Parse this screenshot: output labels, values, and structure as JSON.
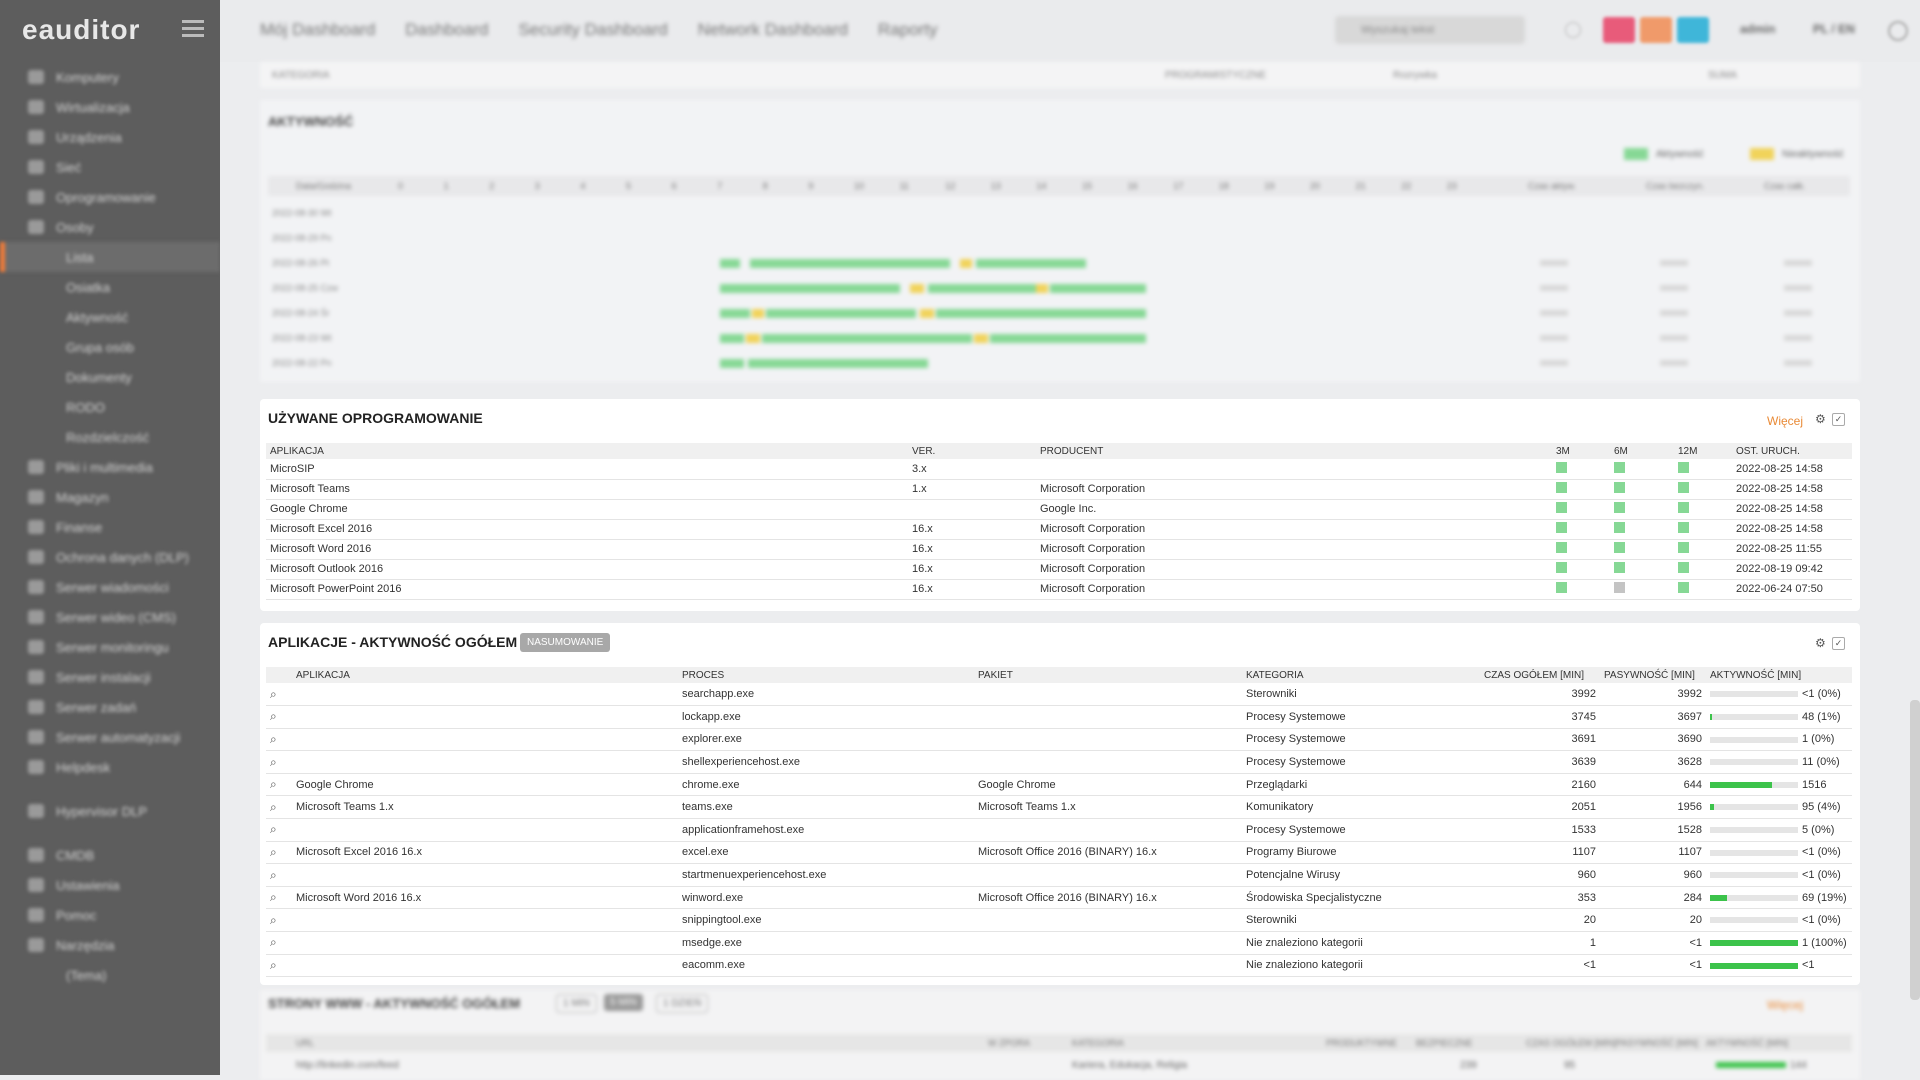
{
  "sidebar": {
    "logo": "eauditor",
    "items": [
      {
        "label": "Komputery",
        "sub": false
      },
      {
        "label": "Wirtualizacja",
        "sub": false
      },
      {
        "label": "Urządzenia",
        "sub": false
      },
      {
        "label": "Sieć",
        "sub": false
      },
      {
        "label": "Oprogramowanie",
        "sub": false
      },
      {
        "label": "Osoby",
        "sub": false
      },
      {
        "label": "Lista",
        "sub": true,
        "active": true
      },
      {
        "label": "Osiatka",
        "sub": true
      },
      {
        "label": "Aktywność",
        "sub": true
      },
      {
        "label": "Grupa osób",
        "sub": true
      },
      {
        "label": "Dokumenty",
        "sub": true
      },
      {
        "label": "RODO",
        "sub": true
      },
      {
        "label": "Rozdzielczość",
        "sub": true
      },
      {
        "label": "Pliki i multimedia",
        "sub": false
      },
      {
        "label": "Magazyn",
        "sub": false
      },
      {
        "label": "Finanse",
        "sub": false
      },
      {
        "label": "Ochrona danych (DLP)",
        "sub": false
      },
      {
        "label": "Serwer wiadomości",
        "sub": false
      },
      {
        "label": "Serwer wideo (CMS)",
        "sub": false
      },
      {
        "label": "Serwer monitoringu",
        "sub": false
      },
      {
        "label": "Serwer instalacji",
        "sub": false
      },
      {
        "label": "Serwer zadań",
        "sub": false
      },
      {
        "label": "Serwer automatyzacji",
        "sub": false
      },
      {
        "label": "Helpdesk",
        "sub": false
      },
      {
        "label": "Hypervisor DLP",
        "sub": false,
        "gap": true
      },
      {
        "label": "CMDB",
        "sub": false,
        "gap": true
      },
      {
        "label": "Ustawienia",
        "sub": false
      },
      {
        "label": "Pomoc",
        "sub": false
      },
      {
        "label": "Narzędzia",
        "sub": false
      },
      {
        "label": "(Tema)",
        "sub": true
      }
    ]
  },
  "topnav": {
    "items": [
      "Mój Dashboard",
      "Dashboard",
      "Security Dashboard",
      "Network Dashboard",
      "Raporty"
    ],
    "search_placeholder": "Wyszukaj tekst",
    "user": "admin",
    "lang": "PL / EN"
  },
  "activity": {
    "title": "AKTYWNOŚĆ",
    "legend": [
      "Aktywność",
      "Nieaktywność"
    ],
    "top_headers": [
      "KATEGORIA",
      "PROGRAMISTYCZNE",
      "Rozrywka",
      "SUMA"
    ],
    "col_head": [
      "Data/Godzina",
      "0",
      "1",
      "2",
      "3",
      "4",
      "5",
      "6",
      "7",
      "8",
      "9",
      "10",
      "11",
      "12",
      "13",
      "14",
      "15",
      "16",
      "17",
      "18",
      "19",
      "20",
      "21",
      "22",
      "23",
      "Czas aktyw.",
      "Czas bezczyn.",
      "Czas całk."
    ],
    "dates": [
      "2022-08-30 Wt",
      "2022-08-29 Pn",
      "2022-08-26 Pt",
      "2022-08-25 Czw",
      "2022-08-24 Śr",
      "2022-08-23 Wt",
      "2022-08-22 Pn"
    ]
  },
  "software": {
    "title": "UŻYWANE OPROGRAMOWANIE",
    "more": "Więcej",
    "headers": {
      "app": "APLIKACJA",
      "ver": "VER.",
      "prod": "PRODUCENT",
      "m3": "3M",
      "m6": "6M",
      "m12": "12M",
      "last": "OST. URUCH."
    },
    "rows": [
      {
        "app": "MicroSIP",
        "ver": "3.x",
        "prod": "",
        "m6gray": false,
        "last": "2022-08-25 14:58"
      },
      {
        "app": "Microsoft Teams",
        "ver": "1.x",
        "prod": "Microsoft Corporation",
        "m6gray": false,
        "last": "2022-08-25 14:58"
      },
      {
        "app": "Google Chrome",
        "ver": "",
        "prod": "Google Inc.",
        "m6gray": false,
        "last": "2022-08-25 14:58"
      },
      {
        "app": "Microsoft Excel 2016",
        "ver": "16.x",
        "prod": "Microsoft Corporation",
        "m6gray": false,
        "last": "2022-08-25 14:58"
      },
      {
        "app": "Microsoft Word 2016",
        "ver": "16.x",
        "prod": "Microsoft Corporation",
        "m6gray": false,
        "last": "2022-08-25 11:55"
      },
      {
        "app": "Microsoft Outlook 2016",
        "ver": "16.x",
        "prod": "Microsoft Corporation",
        "m6gray": false,
        "last": "2022-08-19 09:42"
      },
      {
        "app": "Microsoft PowerPoint 2016",
        "ver": "16.x",
        "prod": "Microsoft Corporation",
        "m6gray": true,
        "last": "2022-06-24 07:50"
      }
    ]
  },
  "apps": {
    "title": "APLIKACJE - AKTYWNOŚĆ OGÓŁEM",
    "badge": "NASUMOWANIE",
    "headers": {
      "app": "APLIKACJA",
      "proc": "PROCES",
      "pkg": "PAKIET",
      "cat": "KATEGORIA",
      "total": "CZAS OGÓŁEM [MIN]",
      "passive": "PASYWNOŚĆ [MIN]",
      "active": "AKTYWNOŚĆ [MIN]"
    },
    "rows": [
      {
        "app": "",
        "proc": "searchapp.exe",
        "pkg": "",
        "cat": "Sterowniki",
        "total": "3992",
        "passive": "3992",
        "active": "<1 (0%)",
        "pct": 0
      },
      {
        "app": "",
        "proc": "lockapp.exe",
        "pkg": "",
        "cat": "Procesy Systemowe",
        "total": "3745",
        "passive": "3697",
        "active": "48 (1%)",
        "pct": 1
      },
      {
        "app": "",
        "proc": "explorer.exe",
        "pkg": "",
        "cat": "Procesy Systemowe",
        "total": "3691",
        "passive": "3690",
        "active": "1 (0%)",
        "pct": 0
      },
      {
        "app": "",
        "proc": "shellexperiencehost.exe",
        "pkg": "",
        "cat": "Procesy Systemowe",
        "total": "3639",
        "passive": "3628",
        "active": "11 (0%)",
        "pct": 0
      },
      {
        "app": "Google Chrome",
        "proc": "chrome.exe",
        "pkg": "Google Chrome",
        "cat": "Przeglądarki",
        "total": "2160",
        "passive": "644",
        "active": "1516",
        "pct": 70
      },
      {
        "app": "Microsoft Teams 1.x",
        "proc": "teams.exe",
        "pkg": "Microsoft Teams 1.x",
        "cat": "Komunikatory",
        "total": "2051",
        "passive": "1956",
        "active": "95 (4%)",
        "pct": 4
      },
      {
        "app": "",
        "proc": "applicationframehost.exe",
        "pkg": "",
        "cat": "Procesy Systemowe",
        "total": "1533",
        "passive": "1528",
        "active": "5 (0%)",
        "pct": 0
      },
      {
        "app": "Microsoft Excel 2016 16.x",
        "proc": "excel.exe",
        "pkg": "Microsoft Office 2016 (BINARY) 16.x",
        "cat": "Programy Biurowe",
        "total": "1107",
        "passive": "1107",
        "active": "<1 (0%)",
        "pct": 0
      },
      {
        "app": "",
        "proc": "startmenuexperiencehost.exe",
        "pkg": "",
        "cat": "Potencjalne Wirusy",
        "total": "960",
        "passive": "960",
        "active": "<1 (0%)",
        "pct": 0
      },
      {
        "app": "Microsoft Word 2016 16.x",
        "proc": "winword.exe",
        "pkg": "Microsoft Office 2016 (BINARY) 16.x",
        "cat": "Środowiska Specjalistyczne",
        "total": "353",
        "passive": "284",
        "active": "69 (19%)",
        "pct": 19
      },
      {
        "app": "",
        "proc": "snippingtool.exe",
        "pkg": "",
        "cat": "Sterowniki",
        "total": "20",
        "passive": "20",
        "active": "<1 (0%)",
        "pct": 0
      },
      {
        "app": "",
        "proc": "msedge.exe",
        "pkg": "",
        "cat": "Nie znaleziono kategorii",
        "total": "1",
        "passive": "<1",
        "active": "1 (100%)",
        "pct": 100
      },
      {
        "app": "",
        "proc": "eacomm.exe",
        "pkg": "",
        "cat": "Nie znaleziono kategorii",
        "total": "<1",
        "passive": "<1",
        "active": "<1",
        "pct": 100
      }
    ]
  },
  "web": {
    "title": "STRONY WWW - AKTYWNOŚĆ OGÓŁEM",
    "tabs": [
      "1 MIN",
      "5 MIN",
      "1 DZIEŃ"
    ],
    "more": "Więcej",
    "headers": [
      "URL",
      "W ZPORA",
      "KATEGORIA",
      "PRODUKTYWNE",
      "BEZPIECZNE",
      "CZAS OGÓŁEM [MIN]",
      "PASYWNOŚĆ [MIN]",
      "AKTYWNOŚĆ [MIN]"
    ],
    "row": {
      "url": "http://linkedin.com/feed",
      "cat": "Kariera, Edukacja, Religia",
      "total": "239",
      "passive": "95",
      "active": "144"
    }
  },
  "colors": {
    "accent": "#f07c3a",
    "green": "#3cc34b",
    "lightgreen": "#86d895",
    "yellow": "#f1d35a"
  }
}
